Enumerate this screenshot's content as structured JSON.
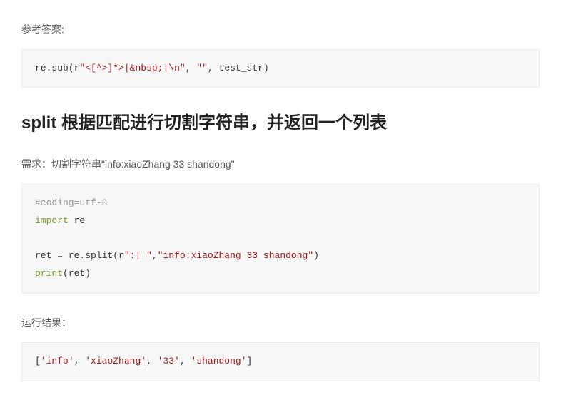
{
  "intro_label": "参考答案:",
  "code1": {
    "fn": "re.sub",
    "lp": "(",
    "arg1_r": "r",
    "arg1_q1": "\"",
    "arg1_body": "<[^>]*>|&nbsp;|\\n",
    "arg1_q2": "\"",
    "c1": ", ",
    "arg2": "\"\"",
    "c2": ", ",
    "arg3": "test_str",
    "rp": ")"
  },
  "heading": "split 根据匹配进行切割字符串，并返回一个列表",
  "demand": "需求：切割字符串\"info:xiaoZhang 33 shandong\"",
  "code2": {
    "l1_comment": "#coding=utf-8",
    "l2_import": "import",
    "l2_mod": " re",
    "l4_a": "ret ",
    "l4_eq": "=",
    "l4_b": " re.split(",
    "l4_r": "r",
    "l4_pat": "\":| \"",
    "l4_c": ",",
    "l4_str": "\"info:xiaoZhang 33 shandong\"",
    "l4_d": ")",
    "l5_a": "print",
    "l5_b": "(ret)"
  },
  "result_label": "运行结果：",
  "code3": {
    "lb": "[",
    "s1": "'info'",
    "c1": ", ",
    "s2": "'xiaoZhang'",
    "c2": ", ",
    "s3": "'33'",
    "c3": ", ",
    "s4": "'shandong'",
    "rb": "]"
  }
}
